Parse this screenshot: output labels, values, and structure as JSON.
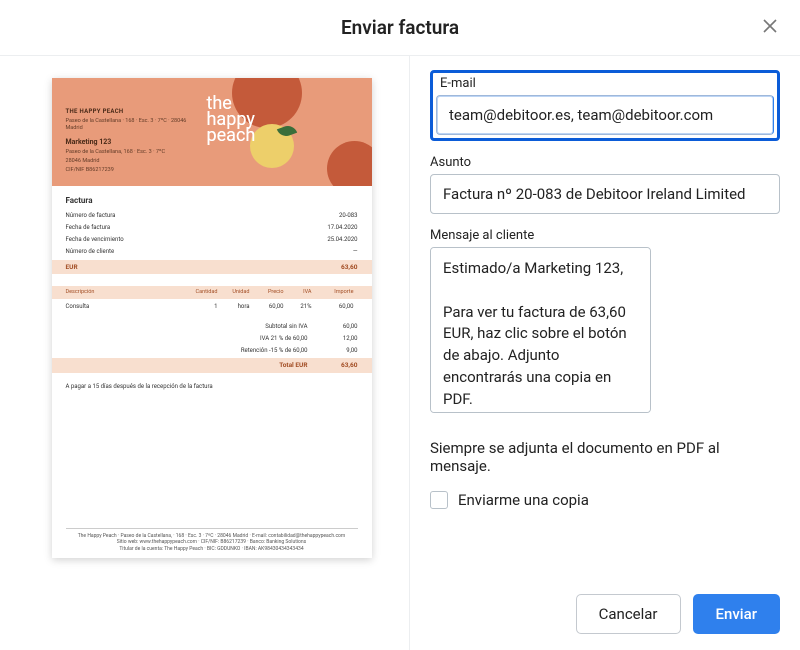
{
  "modal": {
    "title": "Enviar factura"
  },
  "form": {
    "email_label": "E-mail",
    "email_value": "team@debitoor.es, team@debitoor.com",
    "subject_label": "Asunto",
    "subject_value": "Factura nº 20-083 de Debitoor Ireland Limited",
    "message_label": "Mensaje al cliente",
    "message_value": "Estimado/a Marketing 123,\n\nPara ver tu factura de 63,60 EUR, haz clic sobre el botón de abajo. Adjunto encontrarás una copia en PDF.\n\nSaludos,",
    "attach_hint": "Siempre se adjunta el documento en PDF al mensaje.",
    "self_copy_label": "Enviarme una copia",
    "cancel": "Cancelar",
    "send": "Enviar"
  },
  "invoice": {
    "brand_line1": "the",
    "brand_line2": "happy",
    "brand_line3": "peach",
    "company_caps": "The Happy Peach",
    "company_sub": "Paseo de la Castellana · 168 · Esc. 3 · 7ºC · 28046 Madrid",
    "client_name": "Marketing 123",
    "client_addr1": "Paseo de la Castellana, 168 · Esc. 3 · 7ºC",
    "client_addr2": "28046 Madrid",
    "client_tax": "CIF/NIF B86217239",
    "section_title": "Factura",
    "meta_number_label": "Número de factura",
    "meta_number_value": "20-083",
    "meta_date_label": "Fecha de factura",
    "meta_date_value": "17.04.2020",
    "meta_due_label": "Fecha de vencimiento",
    "meta_due_value": "25.04.2020",
    "meta_client_label": "Número de cliente",
    "meta_client_value": "—",
    "eur_label": "EUR",
    "eur_total": "63,60",
    "col_desc": "Descripción",
    "col_qty": "Cantidad",
    "col_unit": "Unidad",
    "col_price": "Precio",
    "col_vat": "IVA",
    "col_amount": "Importe",
    "line_desc": "Consulta",
    "line_qty": "1",
    "line_unit": "hora",
    "line_price": "60,00",
    "line_vat": "21%",
    "line_amount": "60,00",
    "sum_sub_label": "Subtotal sin IVA",
    "sum_sub_val": "60,00",
    "sum_vat_label": "IVA 21 % de 60,00",
    "sum_vat_val": "12,00",
    "sum_ret_label": "Retención -15 % de 60,00",
    "sum_ret_val": "9,00",
    "total_label": "Total EUR",
    "total_val": "63,60",
    "pay_note": "A pagar a 15 días después de la recepción de la factura",
    "footer_line1": "The Happy Peach · Paseo de la Castellana, · 168 · Esc. 3 · 7ºC · 28046 Madrid · E-mail: contabilidad@thehappypeach.com",
    "footer_line2": "Sitio web: www.thehappypeach.com · CIF/NIF: B86217239 · Banco: Banking Solutions",
    "footer_line3": "Titular de la cuenta: The Happy Peach · BIC: GDDUNKO · IBAN: AK98430434343434"
  }
}
